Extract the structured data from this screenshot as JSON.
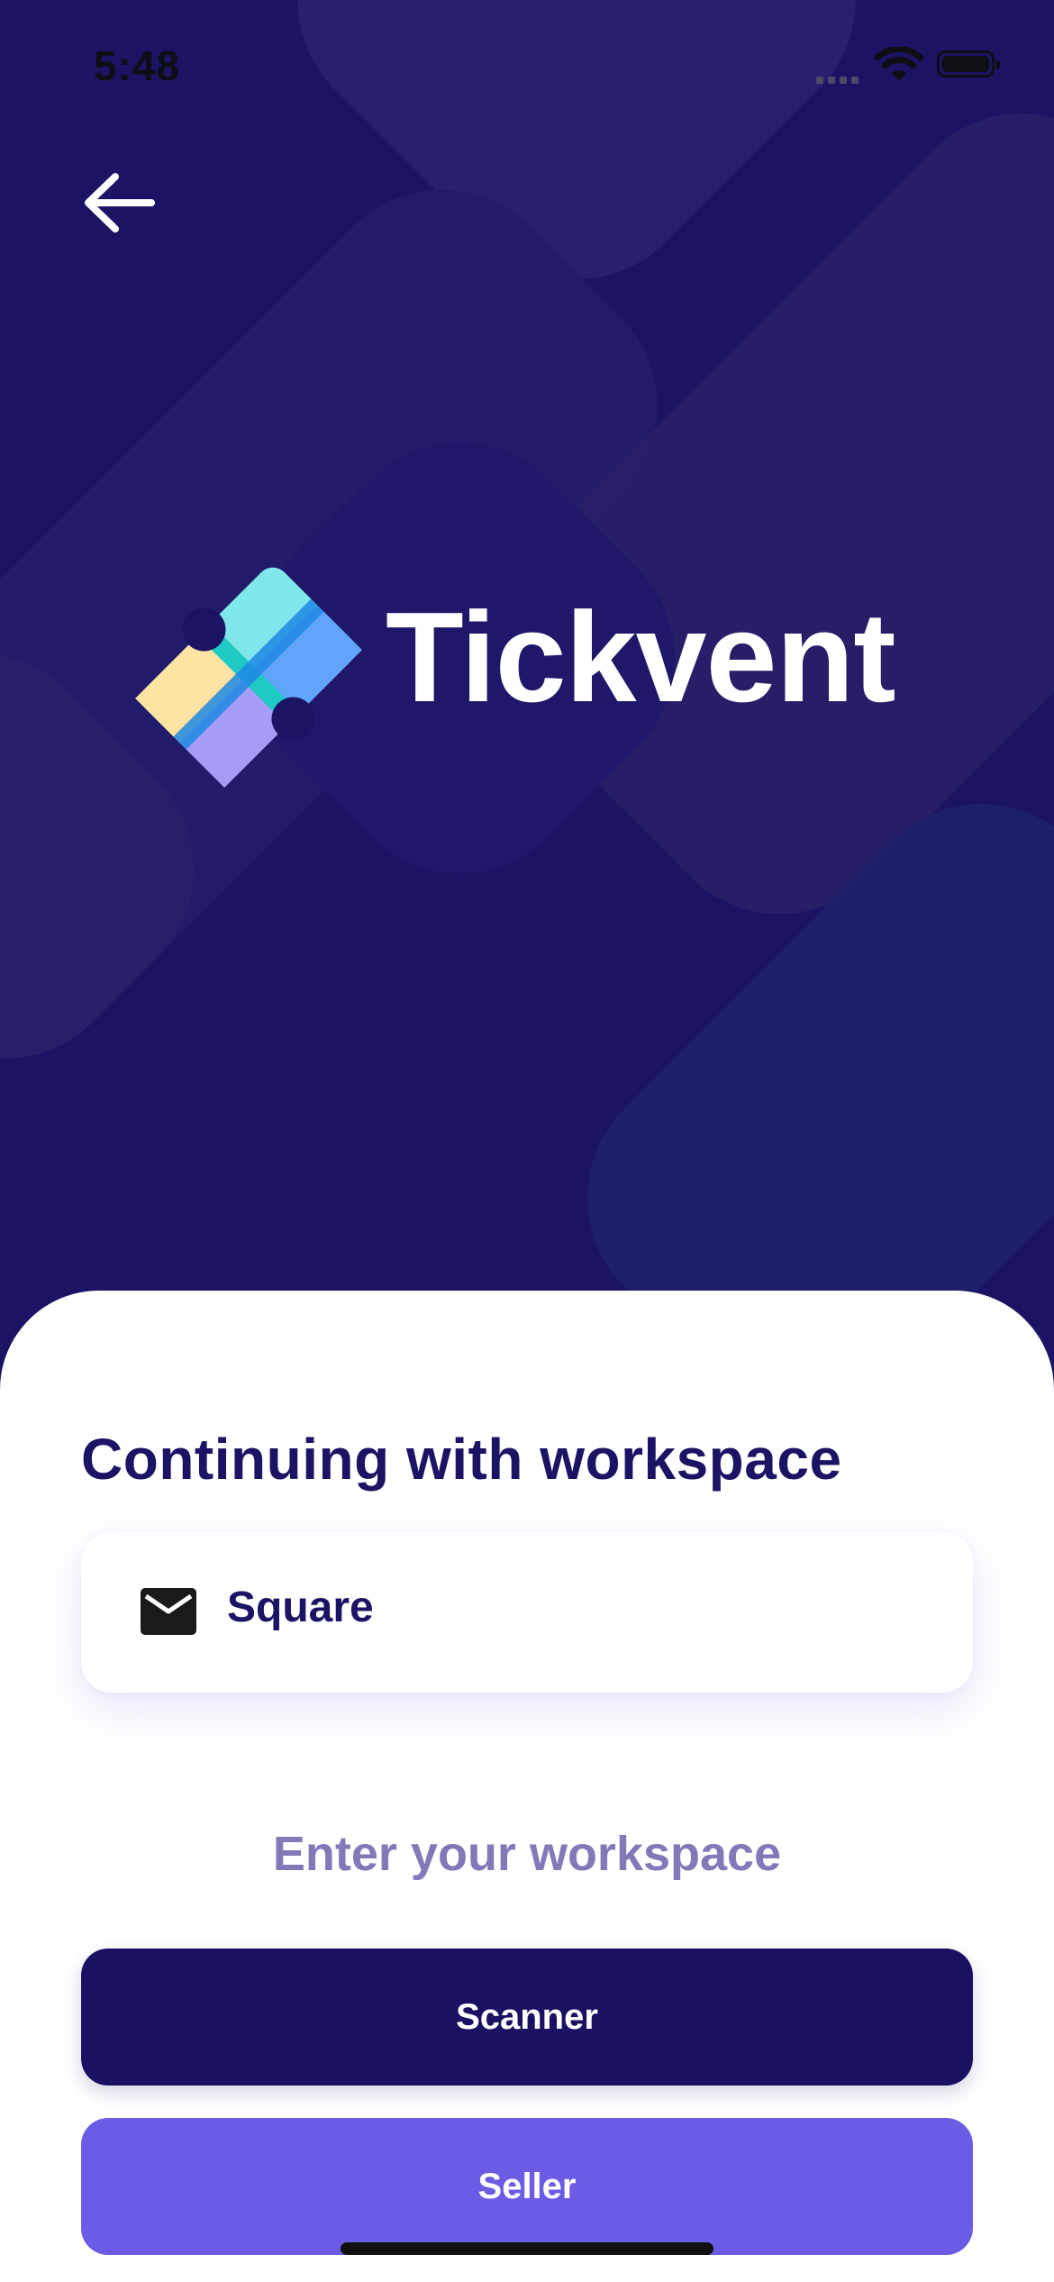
{
  "status_bar": {
    "time": "5:48",
    "icons": [
      "signal-icon",
      "wifi-icon",
      "battery-icon"
    ]
  },
  "header": {
    "back_icon": "arrow-left-icon"
  },
  "brand": {
    "name": "Tickvent",
    "logo_icon": "ticket-logo-icon"
  },
  "sheet": {
    "title": "Continuing with workspace",
    "workspace": {
      "icon": "mail-icon",
      "value": "Square"
    },
    "enter_link": "Enter your workspace",
    "buttons": {
      "scanner": "Scanner",
      "seller": "Seller"
    }
  },
  "colors": {
    "hero_background": "#1b1464",
    "primary_dark": "#1b1162",
    "accent_purple": "#6b5ce6",
    "link_muted": "#8378b8"
  }
}
